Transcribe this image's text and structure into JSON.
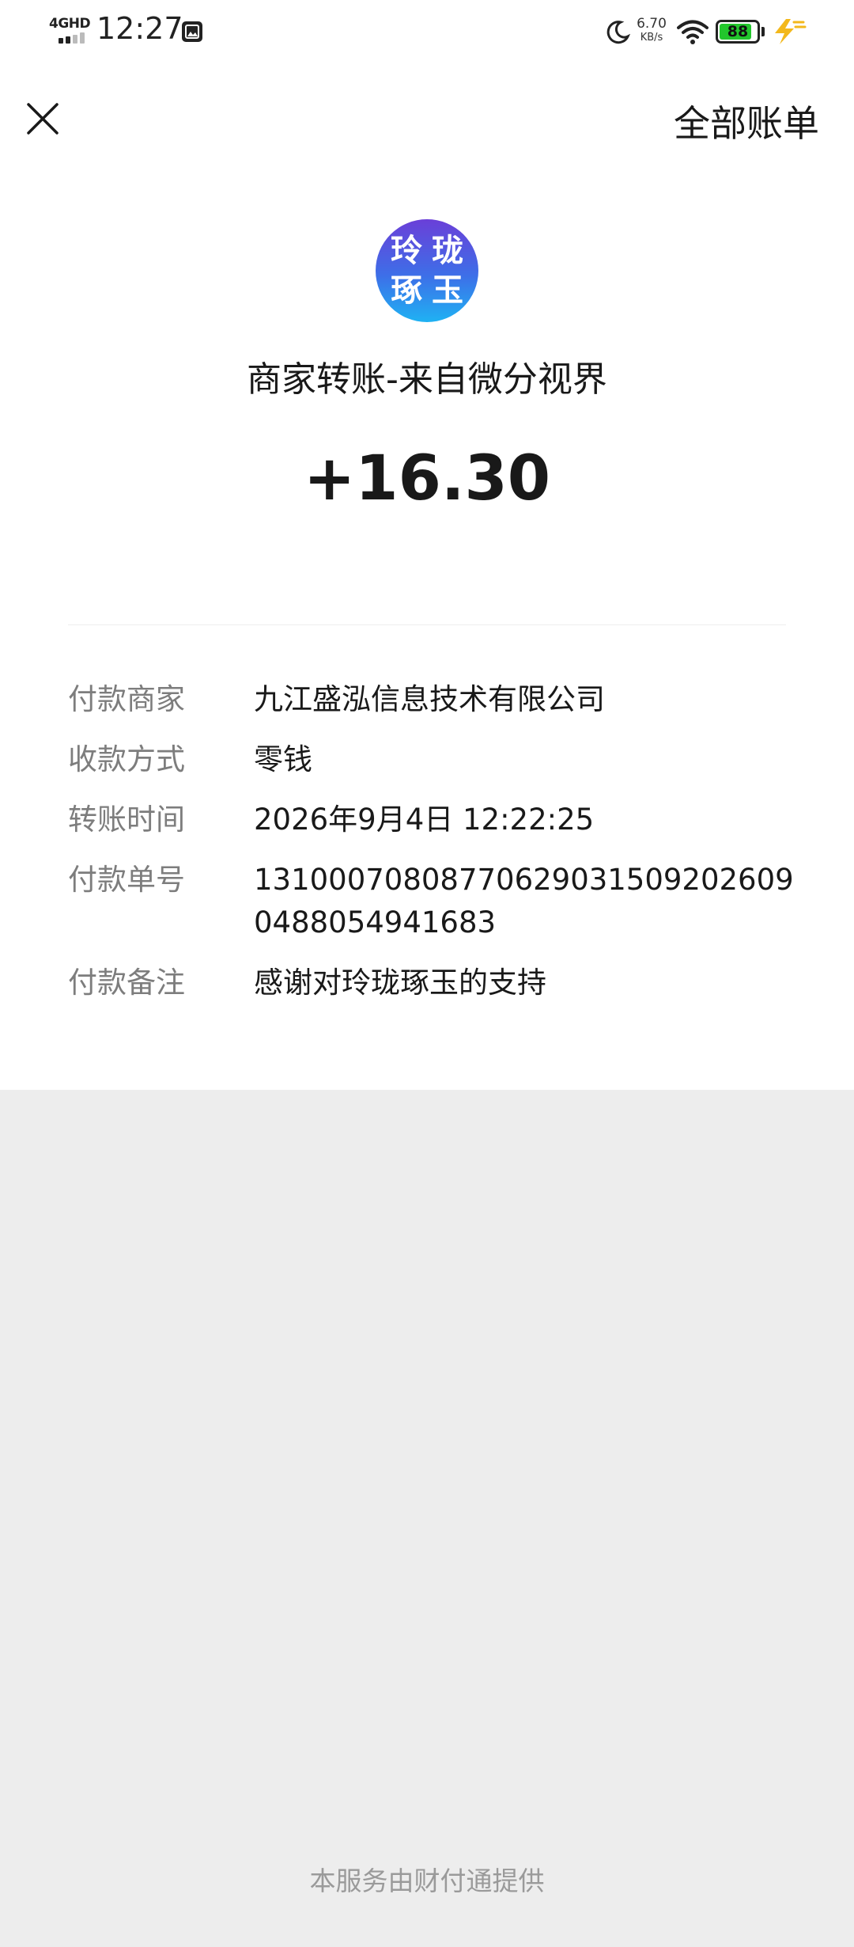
{
  "status_bar": {
    "network": "4GHD",
    "time": "12:27",
    "speed_value": "6.70",
    "speed_unit": "KB/s",
    "battery": "88",
    "battery_level": 0.88
  },
  "header": {
    "all_bills": "全部账单"
  },
  "merchant": {
    "logo_line1": "玲珑",
    "logo_line2": "琢玉",
    "title": "商家转账-来自微分视界",
    "amount": "+16.30"
  },
  "details": {
    "payer_label": "付款商家",
    "payer_value": "九江盛泓信息技术有限公司",
    "method_label": "收款方式",
    "method_value": "零钱",
    "time_label": "转账时间",
    "time_value": "2026年9月4日 12:22:25",
    "order_label": "付款单号",
    "order_value": "131000708087706290315092026090488054941683",
    "remark_label": "付款备注",
    "remark_value": "感谢对玲珑琢玉的支持"
  },
  "footer": {
    "text": "本服务由财付通提供"
  },
  "colors": {
    "background": "#ededed",
    "card": "#ffffff",
    "label": "#7d7d7d",
    "text": "#191919",
    "battery": "#22c62c",
    "charge": "#f3b81b"
  }
}
